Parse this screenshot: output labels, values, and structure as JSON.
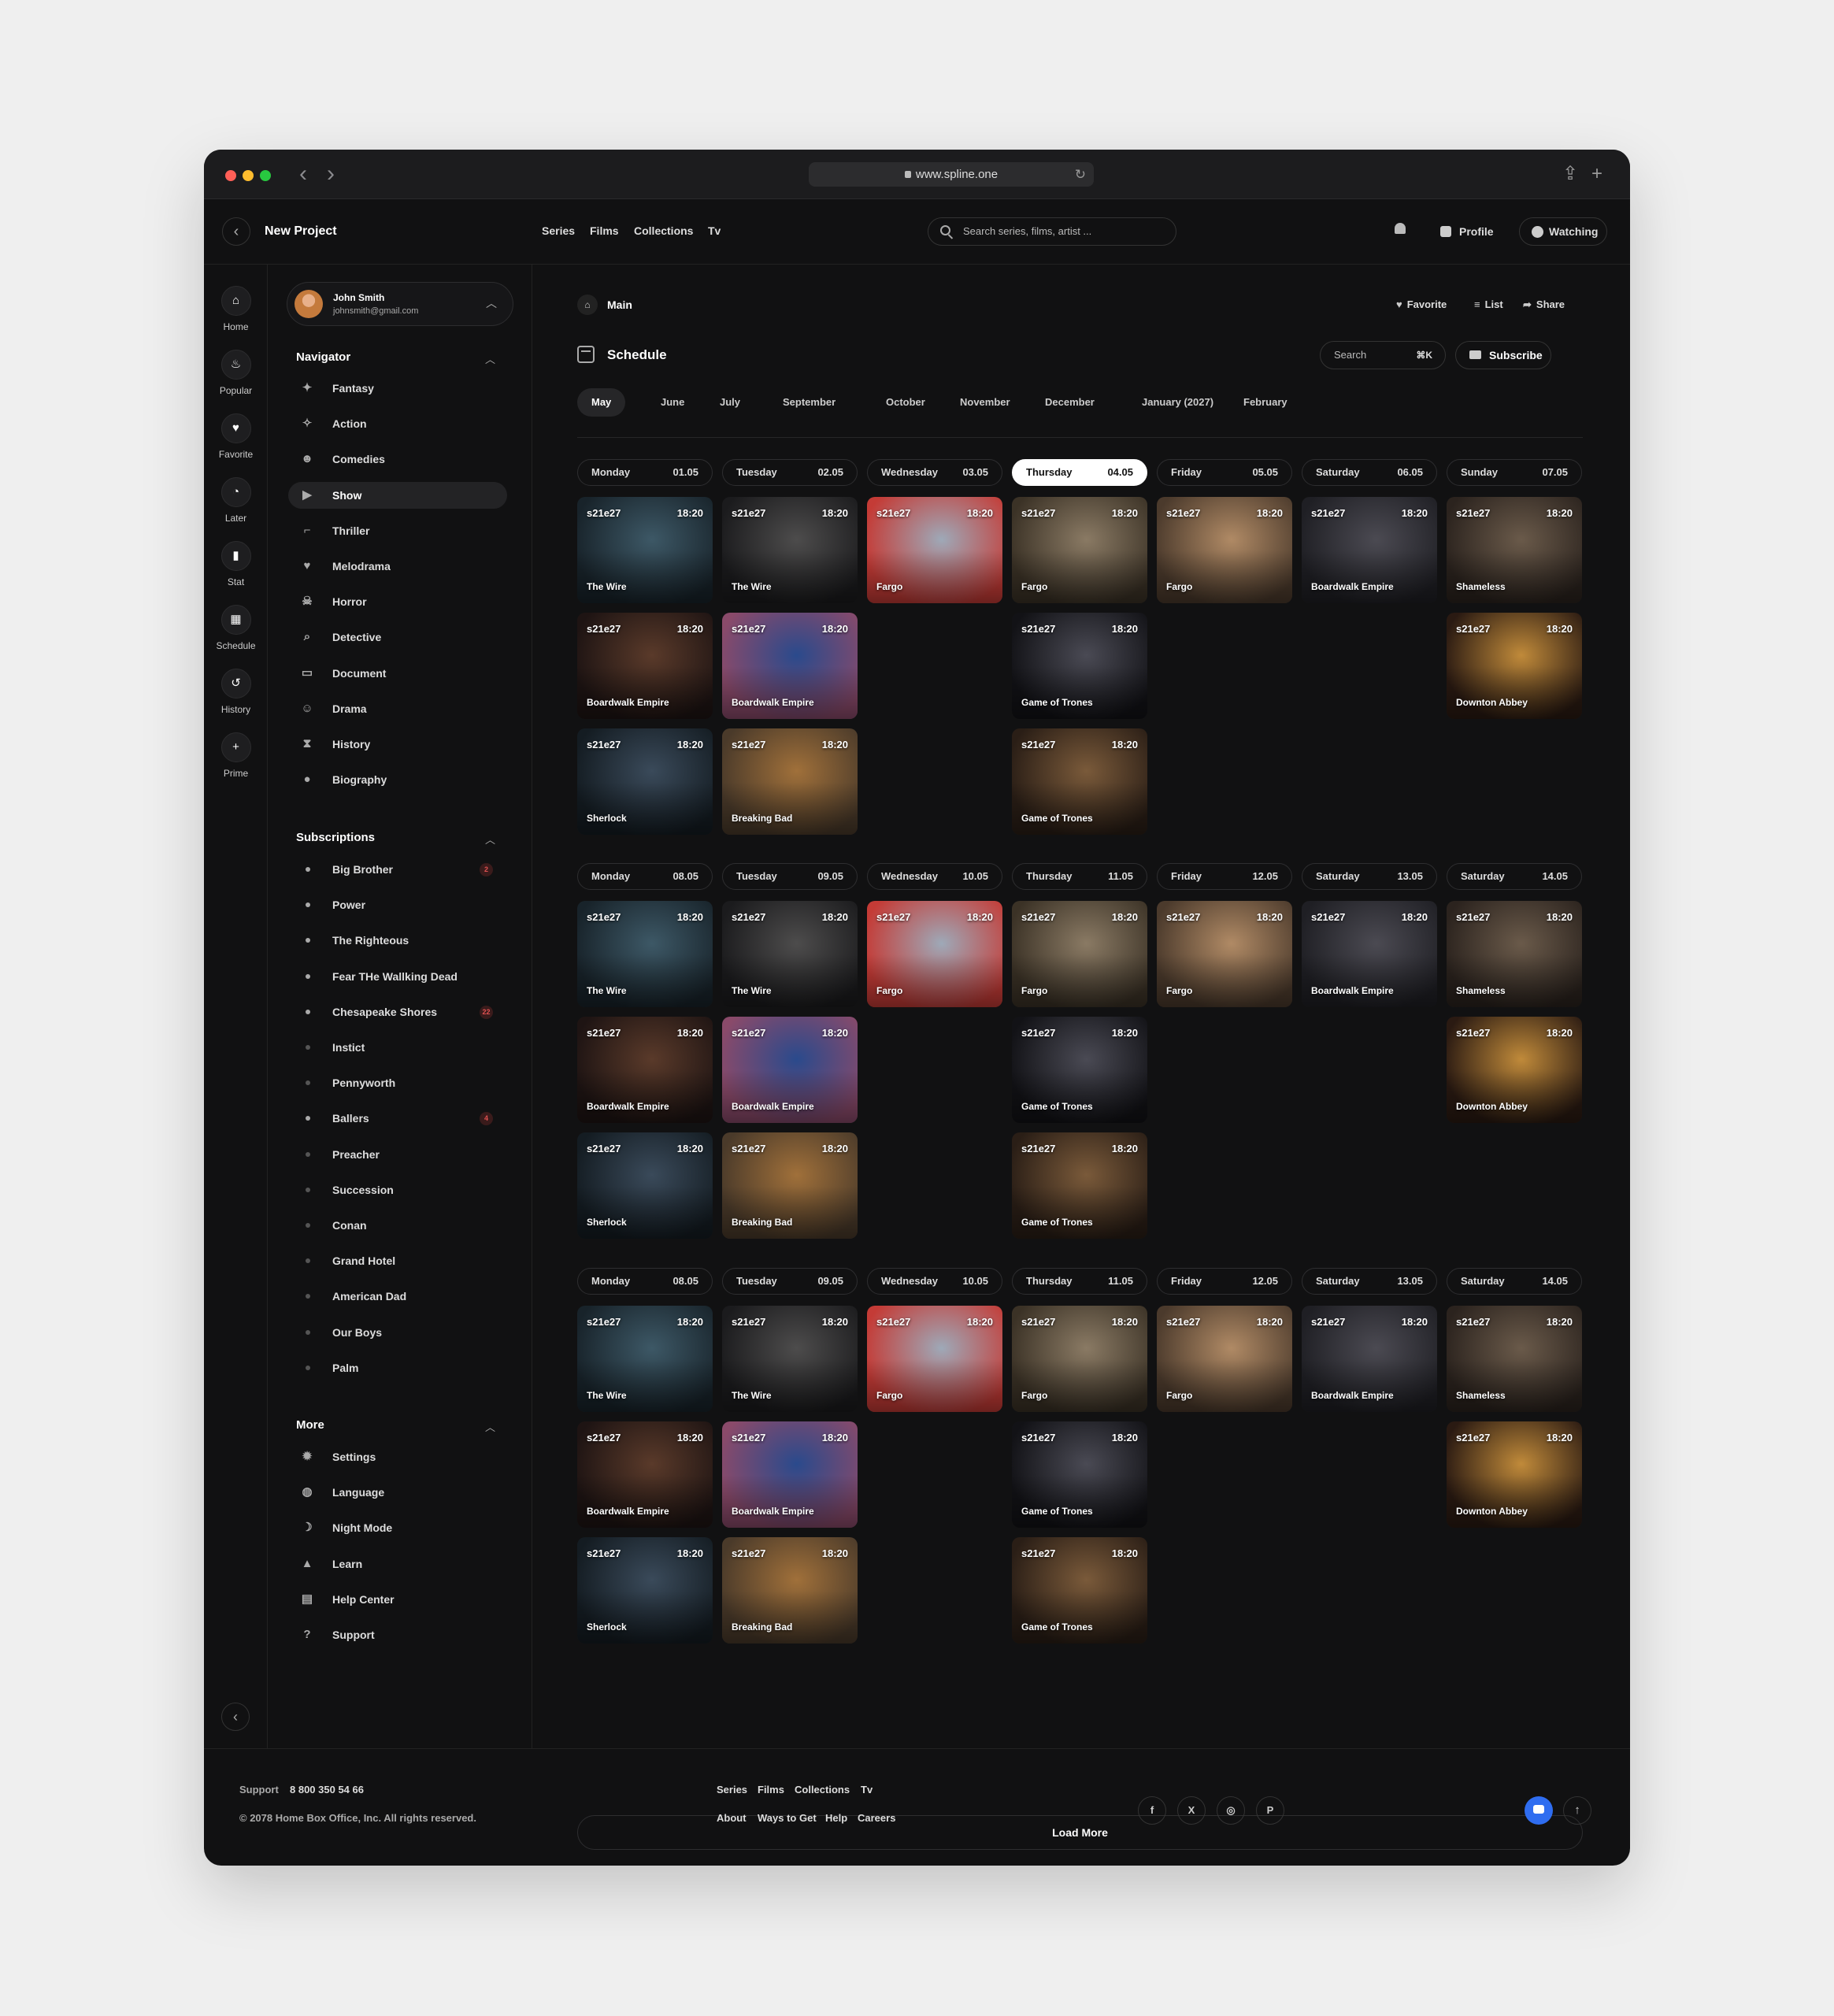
{
  "browser": {
    "url": "www.spline.one"
  },
  "appbar": {
    "project": "New Project",
    "nav": [
      "Series",
      "Films",
      "Collections",
      "Tv"
    ],
    "search_placeholder": "Search series, films, artist ...",
    "profile": "Profile",
    "watching": "Watching"
  },
  "rail": [
    {
      "label": "Home",
      "icon": "home-icon"
    },
    {
      "label": "Popular",
      "icon": "fire-icon"
    },
    {
      "label": "Favorite",
      "icon": "heart-icon"
    },
    {
      "label": "Later",
      "icon": "clock-icon"
    },
    {
      "label": "Stat",
      "icon": "bar-chart-icon"
    },
    {
      "label": "Schedule",
      "icon": "calendar-icon"
    },
    {
      "label": "History",
      "icon": "history-icon"
    },
    {
      "label": "Prime",
      "icon": "plus-icon"
    }
  ],
  "user": {
    "name": "John Smith",
    "email": "johnsmith@gmail.com"
  },
  "navigator": {
    "title": "Navigator",
    "items": [
      {
        "label": "Fantasy",
        "icon": "dragon-icon"
      },
      {
        "label": "Action",
        "icon": "running-icon"
      },
      {
        "label": "Comedies",
        "icon": "mask-icon"
      },
      {
        "label": "Show",
        "icon": "play-icon"
      },
      {
        "label": "Thriller",
        "icon": "gun-icon"
      },
      {
        "label": "Melodrama",
        "icon": "heart-icon"
      },
      {
        "label": "Horror",
        "icon": "skull-icon"
      },
      {
        "label": "Detective",
        "icon": "search-icon"
      },
      {
        "label": "Document",
        "icon": "chat-icon"
      },
      {
        "label": "Drama",
        "icon": "theater-icon"
      },
      {
        "label": "History",
        "icon": "hourglass-icon"
      },
      {
        "label": "Biography",
        "icon": "person-icon"
      }
    ]
  },
  "subscriptions": {
    "title": "Subscriptions",
    "items": [
      {
        "label": "Big Brother",
        "badge": "2"
      },
      {
        "label": "Power",
        "badge": ""
      },
      {
        "label": "The Righteous",
        "badge": ""
      },
      {
        "label": "Fear THe Wallking Dead",
        "badge": ""
      },
      {
        "label": "Chesapeake Shores",
        "badge": "22"
      },
      {
        "label": "Instict",
        "badge": ""
      },
      {
        "label": "Pennyworth",
        "badge": ""
      },
      {
        "label": "Ballers",
        "badge": "4"
      },
      {
        "label": "Preacher",
        "badge": ""
      },
      {
        "label": "Succession",
        "badge": ""
      },
      {
        "label": "Conan",
        "badge": ""
      },
      {
        "label": "Grand Hotel",
        "badge": ""
      },
      {
        "label": "American Dad",
        "badge": ""
      },
      {
        "label": "Our Boys",
        "badge": ""
      },
      {
        "label": "Palm",
        "badge": ""
      }
    ]
  },
  "more": {
    "title": "More",
    "items": [
      {
        "label": "Settings",
        "icon": "gear-icon"
      },
      {
        "label": "Language",
        "icon": "globe-icon"
      },
      {
        "label": "Night Mode",
        "icon": "moon-icon"
      },
      {
        "label": "Learn",
        "icon": "graduation-cap-icon"
      },
      {
        "label": "Help Center",
        "icon": "document-icon"
      },
      {
        "label": "Support",
        "icon": "question-icon"
      }
    ]
  },
  "main": {
    "breadcrumb": "Main",
    "actions": [
      "Favorite",
      "List",
      "Share"
    ],
    "title": "Schedule",
    "search": "Search",
    "shortcut": "⌘K",
    "subscribe": "Subscribe",
    "months": [
      "May",
      "June",
      "July",
      "September",
      "October",
      "November",
      "December",
      "January (2027)",
      "February"
    ],
    "weeks": [
      {
        "days": [
          [
            "Monday",
            "01.05"
          ],
          [
            "Tuesday",
            "02.05"
          ],
          [
            "Wednesday",
            "03.05"
          ],
          [
            "Thursday",
            "04.05"
          ],
          [
            "Friday",
            "05.05"
          ],
          [
            "Saturday",
            "06.05"
          ],
          [
            "Sunday",
            "07.05"
          ]
        ]
      },
      {
        "days": [
          [
            "Monday",
            "08.05"
          ],
          [
            "Tuesday",
            "09.05"
          ],
          [
            "Wednesday",
            "10.05"
          ],
          [
            "Thursday",
            "11.05"
          ],
          [
            "Friday",
            "12.05"
          ],
          [
            "Saturday",
            "13.05"
          ],
          [
            "Saturday",
            "14.05"
          ]
        ]
      },
      {
        "days": [
          [
            "Monday",
            "08.05"
          ],
          [
            "Tuesday",
            "09.05"
          ],
          [
            "Wednesday",
            "10.05"
          ],
          [
            "Thursday",
            "11.05"
          ],
          [
            "Friday",
            "12.05"
          ],
          [
            "Saturday",
            "13.05"
          ],
          [
            "Saturday",
            "14.05"
          ]
        ]
      }
    ],
    "episode": "s21e27",
    "time": "18:20",
    "cards": [
      [
        0,
        0,
        "The Wire"
      ],
      [
        1,
        0,
        "The Wire"
      ],
      [
        2,
        0,
        "Fargo"
      ],
      [
        3,
        0,
        "Fargo"
      ],
      [
        4,
        0,
        "Fargo"
      ],
      [
        5,
        0,
        "Boardwalk Empire"
      ],
      [
        6,
        0,
        "Shameless"
      ],
      [
        0,
        1,
        "Boardwalk Empire"
      ],
      [
        1,
        1,
        "Boardwalk Empire"
      ],
      [
        3,
        1,
        "Game of Trones"
      ],
      [
        6,
        1,
        "Downton Abbey"
      ],
      [
        0,
        2,
        "Sherlock"
      ],
      [
        1,
        2,
        "Breaking Bad"
      ],
      [
        3,
        2,
        "Game of Trones"
      ]
    ],
    "load_more": "Load More"
  },
  "footer": {
    "support": "Support",
    "phone": "8 800 350 54 66",
    "copyright": "© 2078 Home Box Office, Inc. All rights reserved.",
    "nav1": [
      "Series",
      "Films",
      "Collections",
      "Tv"
    ],
    "nav2": [
      "About",
      "Ways to Get",
      "Help",
      "Careers"
    ],
    "social": [
      "f",
      "X",
      "◎",
      "P"
    ]
  },
  "colors": {
    "close": "#ff5f57",
    "minimize": "#febc2e",
    "zoom": "#28c840",
    "accent": "#2f6df0",
    "badge": "#e05151"
  }
}
